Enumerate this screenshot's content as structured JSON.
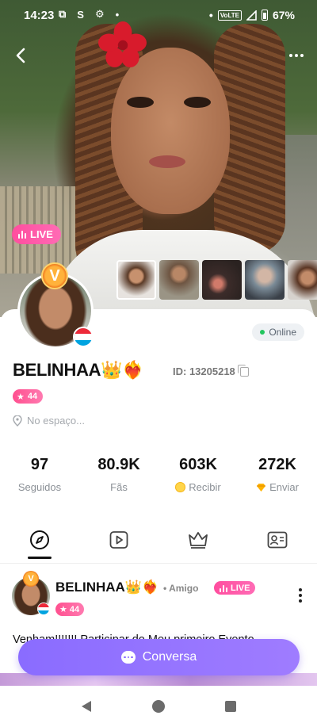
{
  "status_bar": {
    "time": "14:23",
    "network": "VoLTE",
    "battery": "67%"
  },
  "hero": {
    "live_label": "LIVE",
    "photo_count": 5
  },
  "profile": {
    "crown_letter": "V",
    "online_label": "Online",
    "name": "BELINHAA👑❤️‍🔥",
    "id_label": "ID: 13205218",
    "level": "44",
    "location": "No espaço...",
    "online_color": "#22c55e",
    "level_color": "#ff4f8f"
  },
  "stats": [
    {
      "value": "97",
      "label": "Seguidos",
      "icon": ""
    },
    {
      "value": "80.9K",
      "label": "Fãs",
      "icon": ""
    },
    {
      "value": "603K",
      "label": "Recibir",
      "icon": "coin-icon"
    },
    {
      "value": "272K",
      "label": "Enviar",
      "icon": "gem-icon"
    }
  ],
  "tabs": [
    {
      "icon": "compass-icon",
      "active": true
    },
    {
      "icon": "video-play-icon",
      "active": false
    },
    {
      "icon": "crown-icon",
      "active": false
    },
    {
      "icon": "profile-card-icon",
      "active": false
    }
  ],
  "post": {
    "name": "BELINHAA👑❤️‍🔥",
    "relation": "• Amigo",
    "live_label": "LIVE",
    "level": "44",
    "text": "Venham!!!!!!! Participar do Meu primeiro Evento"
  },
  "chat_button": {
    "label": "Conversa",
    "color": "#8a6cff"
  },
  "flag": {
    "colors": [
      "#ed2939",
      "#ffffff",
      "#00a3e0"
    ]
  }
}
